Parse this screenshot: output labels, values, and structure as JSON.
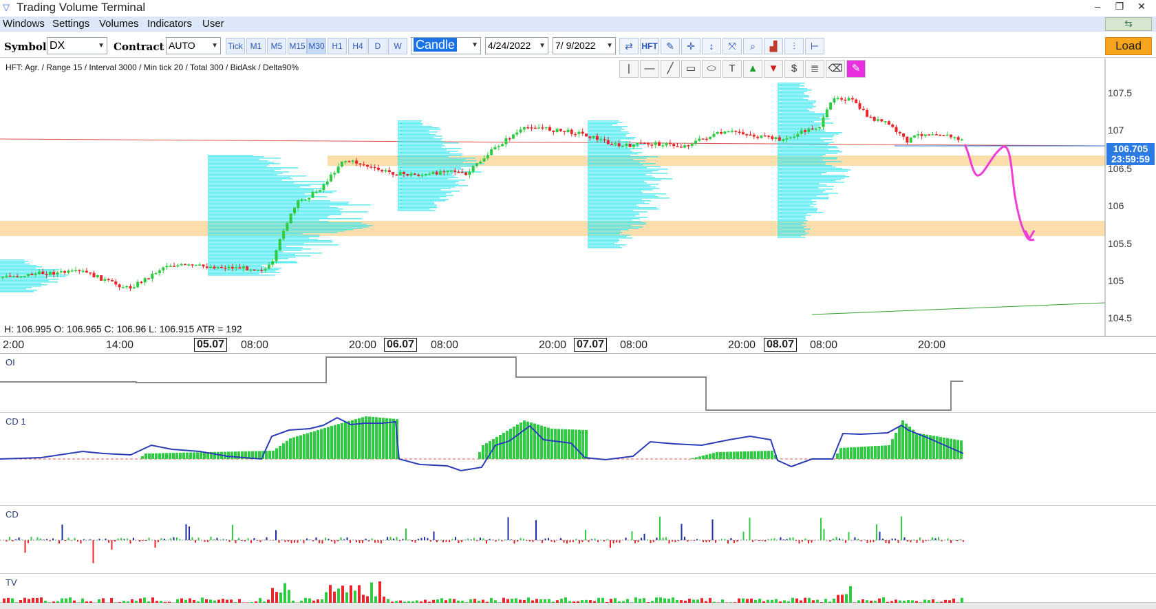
{
  "window": {
    "title": "Trading Volume Terminal"
  },
  "menu": {
    "items": [
      "Windows",
      "Settings",
      "Volumes",
      "Indicators",
      "User"
    ]
  },
  "toolbar": {
    "symbol_label": "Symbol",
    "symbol_value": "DX",
    "contract_label": "Contract",
    "contract_value": "AUTO",
    "timeframes": [
      "Tick",
      "M1",
      "M5",
      "M15",
      "M30",
      "H1",
      "H4",
      "D",
      "W"
    ],
    "active_timeframe": "M30",
    "chart_type": "Candle",
    "date_from": "4/24/2022",
    "date_to": "7/ 9/2022",
    "hft_label": "HFT",
    "load_label": "Load"
  },
  "chart": {
    "hft_info": "HFT: Agr. / Range 15 / Interval 3000 / Min tick 20 / Total 300 / BidAsk / Delta90%",
    "ohlc_info": "H: 106.995  O: 106.965  C: 106.96  L: 106.915  ATR = 192",
    "price_ticks": [
      "107.5",
      "107",
      "106.5",
      "106",
      "105.5",
      "105",
      "104.5"
    ],
    "current_price": "106.705",
    "countdown": "23:59:59",
    "time_ticks": [
      {
        "label": "2:00",
        "day": false
      },
      {
        "label": "14:00",
        "day": false
      },
      {
        "label": "05.07",
        "day": true
      },
      {
        "label": "08:00",
        "day": false
      },
      {
        "label": "20:00",
        "day": false
      },
      {
        "label": "06.07",
        "day": true
      },
      {
        "label": "08:00",
        "day": false
      },
      {
        "label": "20:00",
        "day": false
      },
      {
        "label": "07.07",
        "day": true
      },
      {
        "label": "08:00",
        "day": false
      },
      {
        "label": "20:00",
        "day": false
      },
      {
        "label": "08.07",
        "day": true
      },
      {
        "label": "08:00",
        "day": false
      },
      {
        "label": "20:00",
        "day": false
      }
    ],
    "colors": {
      "up": "#2ecc40",
      "down": "#e8262b",
      "profile": "#33e5f0",
      "zone": "#fcdca4",
      "forecast": "#f03cd8",
      "accent": "#2c7be5"
    }
  },
  "panes": {
    "oi_label": "OI",
    "cd1_label": "CD 1",
    "cd_label": "CD",
    "tv_label": "TV"
  }
}
